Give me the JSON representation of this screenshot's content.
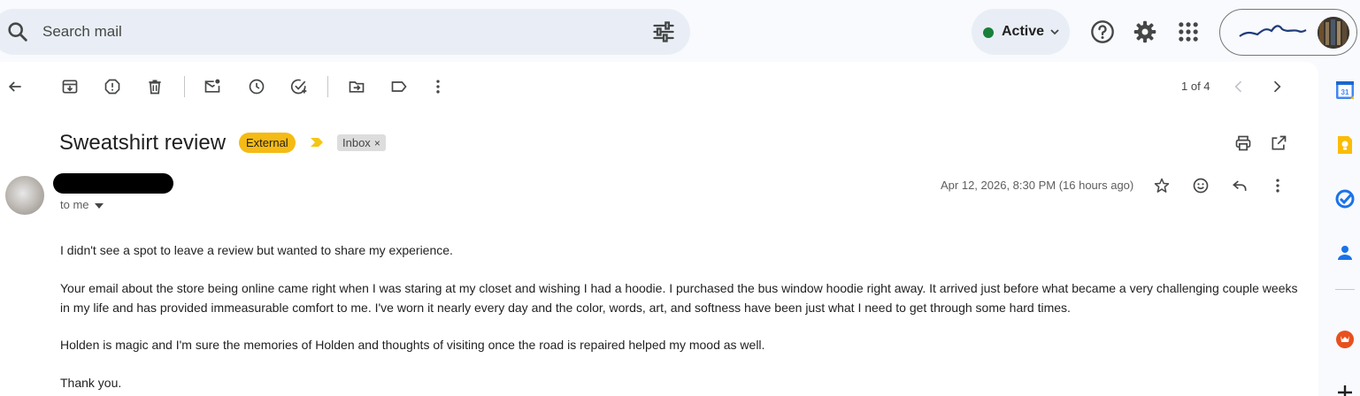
{
  "search": {
    "placeholder": "Search mail"
  },
  "status": {
    "label": "Active",
    "color": "#188038"
  },
  "header_icons": [
    "help-icon",
    "settings-gear-icon",
    "apps-grid-icon"
  ],
  "toolbar": {
    "icons": [
      "back-arrow-icon",
      "archive-icon",
      "report-spam-icon",
      "delete-icon",
      "mark-unread-icon",
      "snooze-icon",
      "add-to-tasks-icon",
      "move-to-icon",
      "label-icon",
      "more-vert-icon"
    ],
    "pager": "1 of 4"
  },
  "message": {
    "subject": "Sweatshirt review",
    "badges": {
      "external": "External",
      "inbox": "Inbox",
      "inbox_remove": "×"
    },
    "external_color": "#f5ba14",
    "recipient": "to me",
    "date": "Apr 12, 2026, 8:30 PM (16 hours ago)",
    "body": [
      "I didn't see a spot to leave a review but wanted to share my experience.",
      "Your email about the store being online came right when I was staring at my closet and wishing I had a hoodie. I purchased the bus window hoodie right away. It arrived just before what became a very challenging couple weeks in my life and has provided immeasurable comfort to me. I've worn it nearly every day and the color, words, art, and softness have been just what I need to get through some hard times.",
      "Holden is magic and I'm sure the memories of Holden and thoughts of visiting once the road is repaired helped my mood as well.",
      "Thank you."
    ]
  },
  "side_panel": {
    "calendar_day": "31",
    "apps": [
      "calendar-icon",
      "keep-icon",
      "tasks-icon",
      "contacts-icon",
      "addon-icon",
      "get-addons-plus-icon"
    ]
  }
}
